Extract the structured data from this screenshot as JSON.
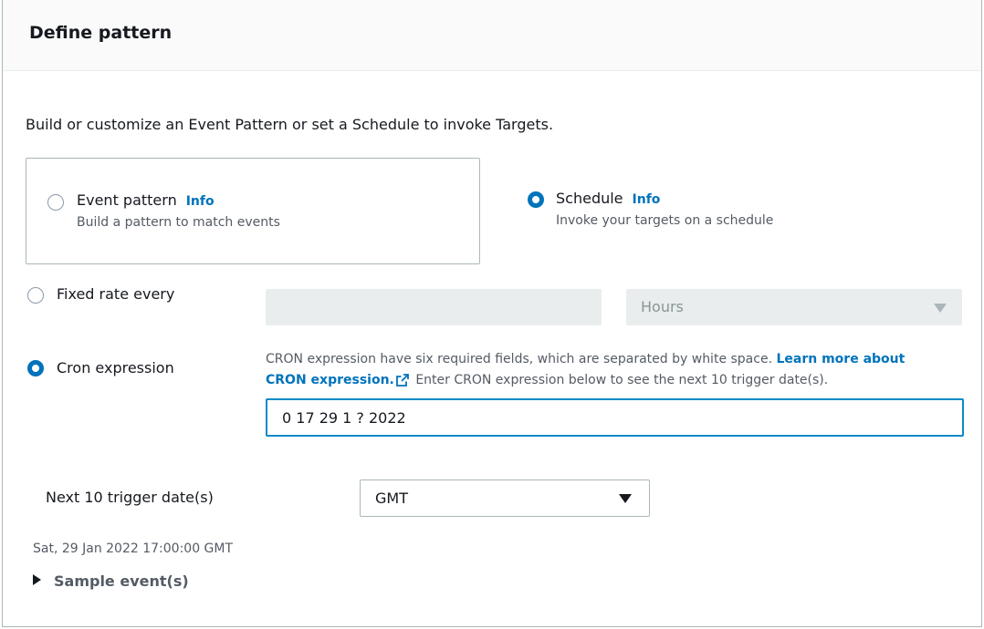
{
  "panel": {
    "title": "Define pattern",
    "description": "Build or customize an Event Pattern or set a Schedule to invoke Targets."
  },
  "pattern_type": {
    "event_pattern": {
      "label": "Event pattern",
      "info": "Info",
      "description": "Build a pattern to match events",
      "selected": false
    },
    "schedule": {
      "label": "Schedule",
      "info": "Info",
      "description": "Invoke your targets on a schedule",
      "selected": true
    }
  },
  "schedule": {
    "fixed_rate": {
      "label": "Fixed rate every",
      "selected": false,
      "value": "",
      "unit": "Hours"
    },
    "cron": {
      "label": "Cron expression",
      "selected": true,
      "help_prefix": "CRON expression have six required fields, which are separated by white space.",
      "help_link": "Learn more about CRON expression.",
      "help_suffix": "Enter CRON expression below to see the next 10 trigger date(s).",
      "value": "0 17 29 1 ? 2022"
    }
  },
  "triggers": {
    "label": "Next 10 trigger date(s)",
    "timezone": "GMT",
    "dates": [
      "Sat, 29 Jan 2022 17:00:00 GMT"
    ]
  },
  "sample_events": {
    "label": "Sample event(s)"
  },
  "icons": {
    "external_link": "external-link-icon",
    "expand": "caret-right-icon",
    "dropdown": "caret-down-icon"
  },
  "colors": {
    "accent": "#0073bb",
    "focus_border": "#0a8ac7",
    "disabled_fill": "#eaeded",
    "text": "#16191f",
    "secondary_text": "#545b64"
  }
}
